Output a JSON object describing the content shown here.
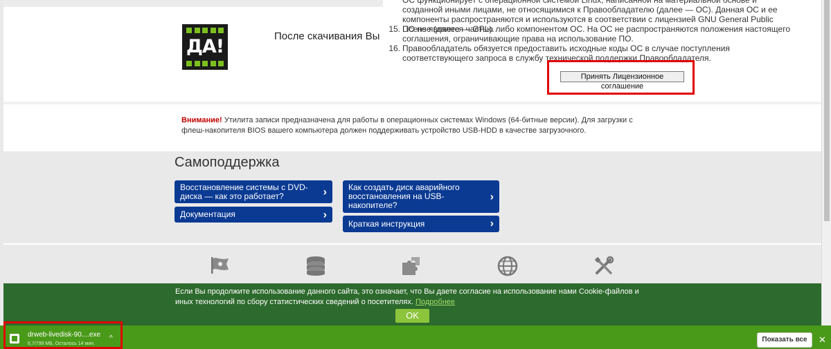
{
  "logo": {
    "text": "ДА!"
  },
  "download_text": "После скачивания Вы буд",
  "license": {
    "items": [
      {
        "num": "",
        "text": "ОС функционирует с операционной системой Linux, написанной на материальной основе и созданной иными лицами, не относящимися к Правообладателю (далее — ОС). Данная ОС и ее компоненты распространяются и используются в соответствии с лицензией GNU General Public License (далее — GPL)."
      },
      {
        "num": "15.",
        "text": "ПО не является частью либо компонентом ОС. На ОС не распространяются положения настоящего соглашения, ограничивающие права на использование ПО."
      },
      {
        "num": "16.",
        "text": "Правообладатель обязуется предоставить исходные коды ОС в случае поступления соответствующего запроса в службу технической поддержки Правообладателя."
      }
    ],
    "accept_button": "Принять Лицензионное соглашение"
  },
  "notice": {
    "warn": "Внимание!",
    "text": " Утилита записи предназначена для работы в операционных системах Windows (64-битные версии). Для загрузки с флеш-накопителя BIOS вашего компьютера должен поддерживать устройство USB-HDD в качестве загрузочного."
  },
  "selfhelp": {
    "title": "Самоподдержка",
    "buttons": [
      "Восстановление системы с DVD-диска — как это работает?",
      "Документация",
      "Как создать диск аварийного восстановления на USB-накопителе?",
      "Краткая инструкция"
    ],
    "chevron": "›"
  },
  "icons": [
    "flag-icon",
    "database-icon",
    "puzzle-icon",
    "globe-icon",
    "tools-icon"
  ],
  "cookie": {
    "text": "Если Вы продолжите использование данного сайта, это означает, что Вы даете согласие на использование нами Cookie-файлов и иных технологий по сбору статистических сведений о посетителях.",
    "link": "Подробнее",
    "ok": "OK"
  },
  "download_bar": {
    "file_name": "drweb-livedisk-90....exe",
    "status": "6,7/799 МБ, Осталось 14 мин.",
    "caret": "^",
    "show_all": "Показать все",
    "close": "✕"
  },
  "colors": {
    "brand_green": "#7cbf1f",
    "blue_button": "#0b3a93",
    "cookie_green": "#2d6a2d",
    "download_bar_green": "#4a9a1a",
    "highlight_red": "#e00000"
  }
}
